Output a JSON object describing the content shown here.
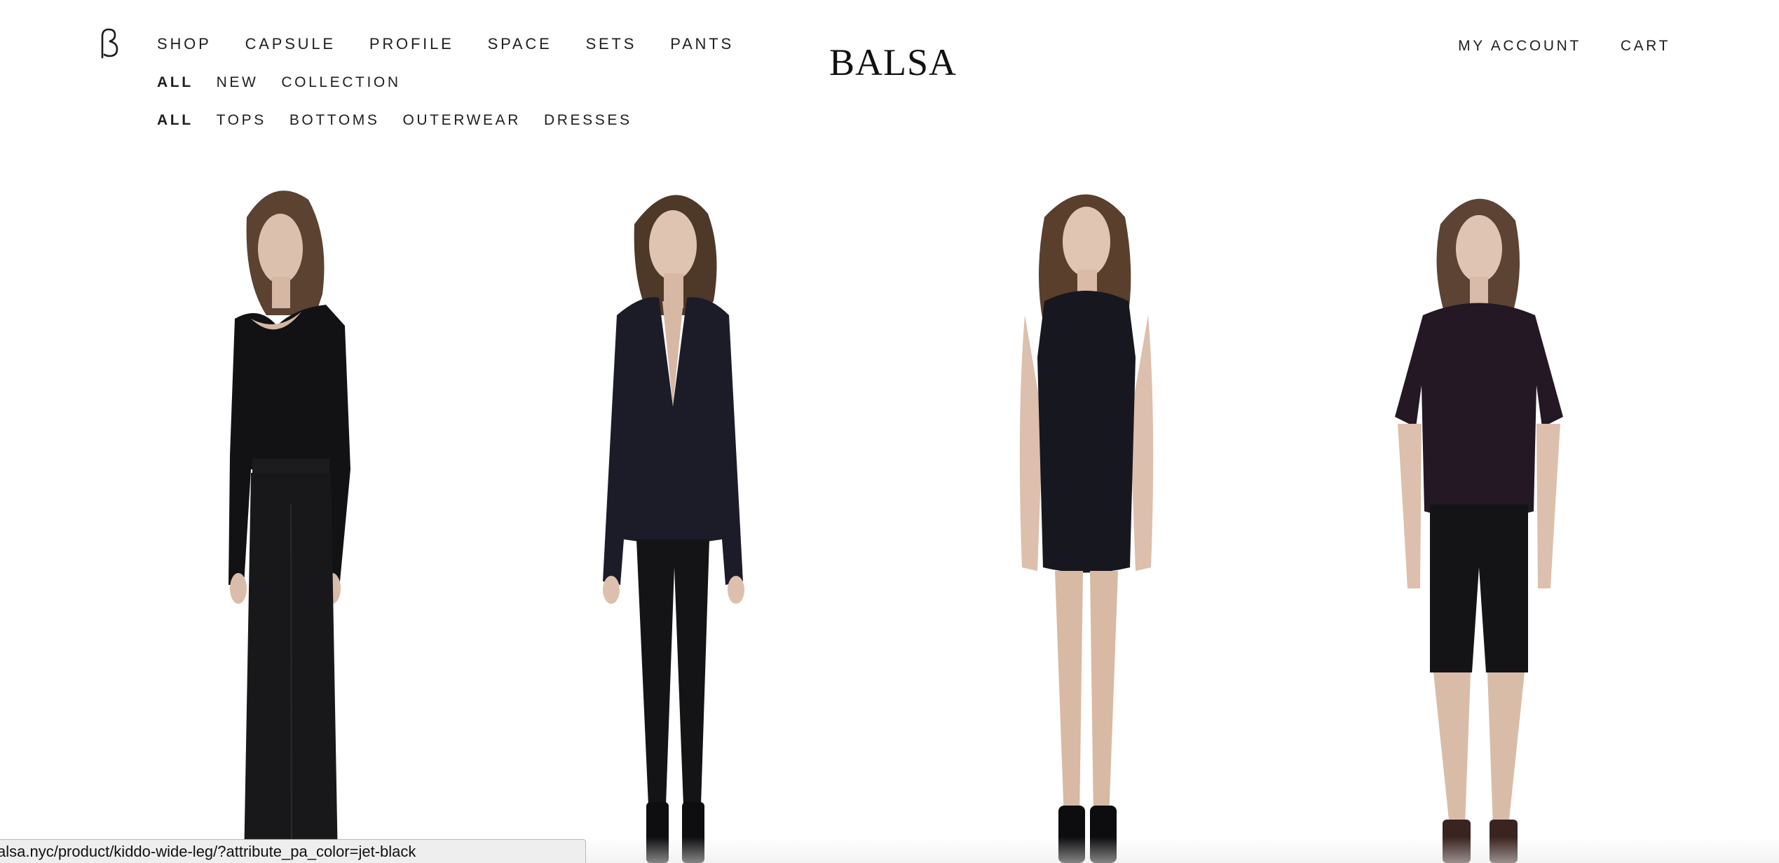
{
  "header": {
    "logo": "BALSA",
    "brand_mark": "ß",
    "primary_nav": [
      "SHOP",
      "CAPSULE",
      "PROFILE",
      "SPACE",
      "SETS",
      "PANTS"
    ],
    "sub_nav": [
      "ALL",
      "NEW",
      "COLLECTION"
    ],
    "category_nav": [
      "ALL",
      "TOPS",
      "BOTTOMS",
      "OUTERWEAR",
      "DRESSES"
    ],
    "account_nav": [
      "MY ACCOUNT",
      "CART"
    ]
  },
  "products": [
    {
      "name": "model-long-sleeve-wide-leg",
      "icon": "product-image"
    },
    {
      "name": "model-jacket-leggings",
      "icon": "product-image"
    },
    {
      "name": "model-sleeveless-dress",
      "icon": "product-image"
    },
    {
      "name": "model-tee-shorts",
      "icon": "product-image"
    }
  ],
  "status_bar": {
    "url": "alsa.nyc/product/kiddo-wide-leg/?attribute_pa_color=jet-black"
  },
  "colors": {
    "background": "#ffffff",
    "text": "#1e1e1e",
    "garment": "#141418",
    "skin": "#dcbfae",
    "hair": "#5a4030"
  }
}
